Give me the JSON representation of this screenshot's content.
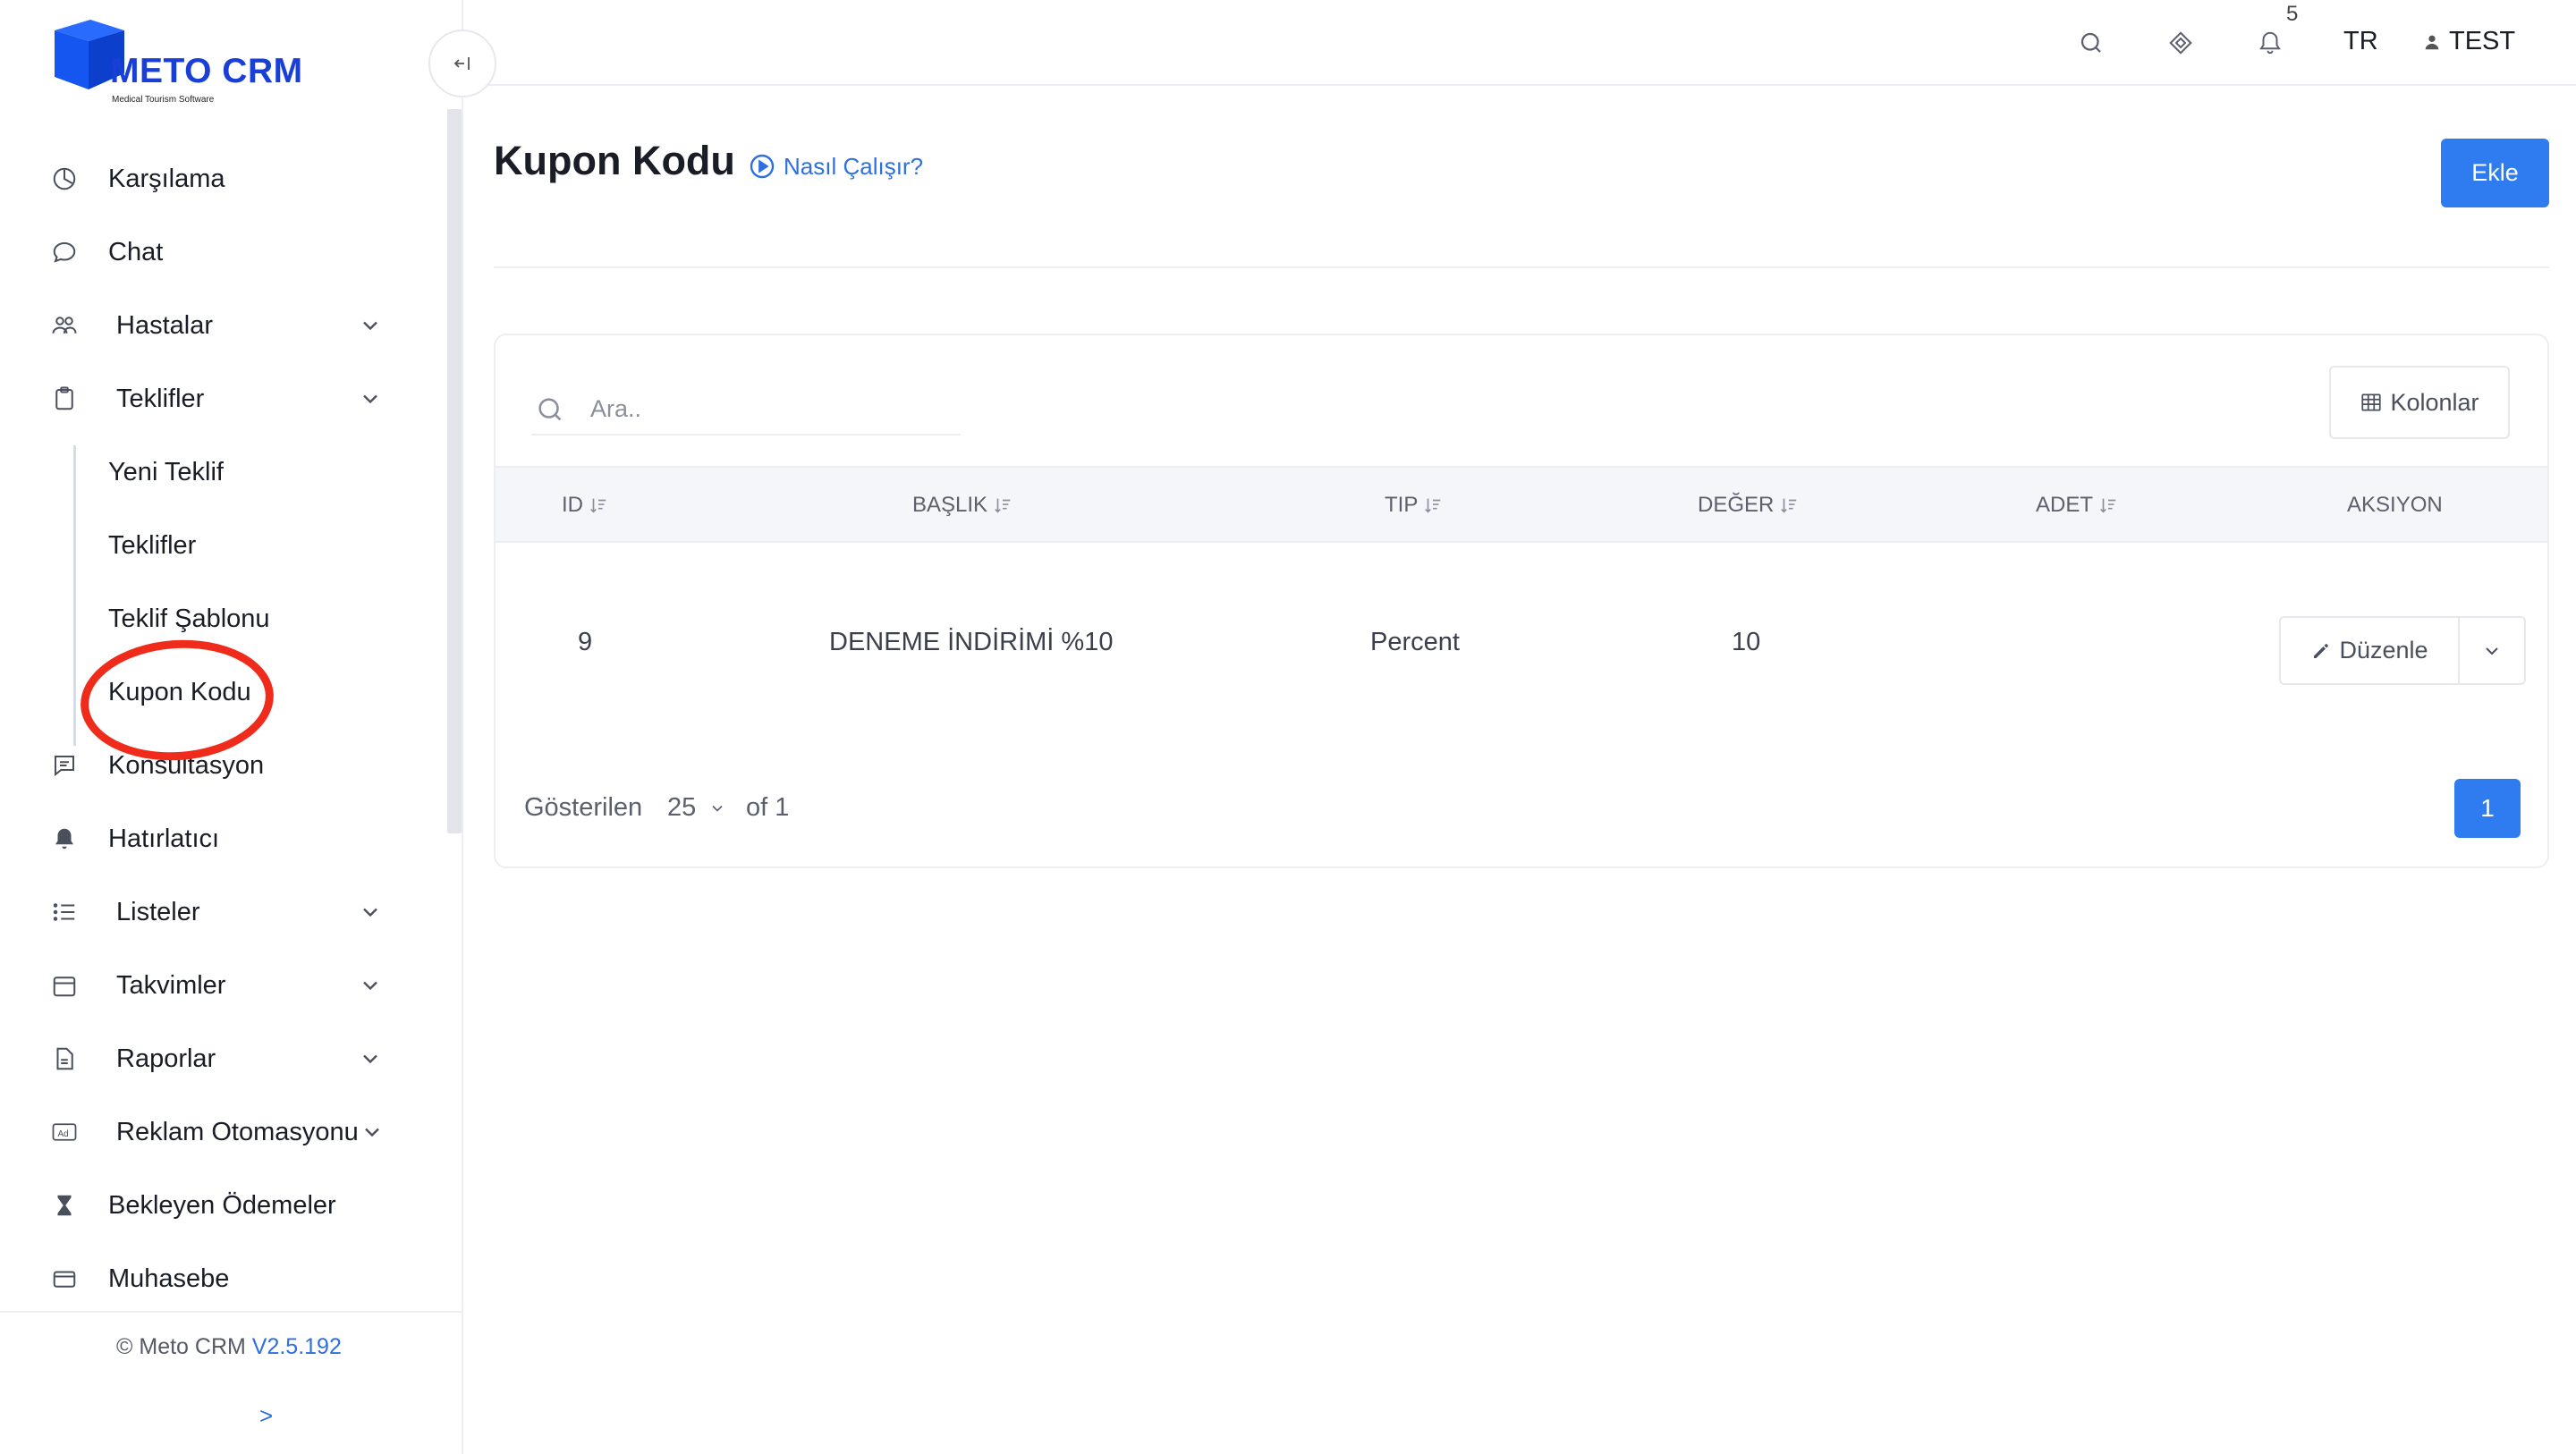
{
  "brand": {
    "name": "METO CRM",
    "tagline": "Medical Tourism Software",
    "accent": "#1a3fd6"
  },
  "sidebar": {
    "items": [
      {
        "label": "Karşılama",
        "icon": "dashboard-icon"
      },
      {
        "label": "Chat",
        "icon": "chat-icon"
      },
      {
        "label": "Hastalar",
        "icon": "users-icon",
        "expandable": true
      },
      {
        "label": "Teklifler",
        "icon": "clipboard-icon",
        "expandable": true,
        "expanded": true
      },
      {
        "label": "Yeni Teklif",
        "sub": true
      },
      {
        "label": "Teklifler",
        "sub": true
      },
      {
        "label": "Teklif Şablonu",
        "sub": true
      },
      {
        "label": "Kupon Kodu",
        "sub": true,
        "active": true
      },
      {
        "label": "Konsultasyon",
        "icon": "message-square-icon"
      },
      {
        "label": "Hatırlatıcı",
        "icon": "bell-icon"
      },
      {
        "label": "Listeler",
        "icon": "list-icon",
        "expandable": true
      },
      {
        "label": "Takvimler",
        "icon": "calendar-icon",
        "expandable": true
      },
      {
        "label": "Raporlar",
        "icon": "file-icon",
        "expandable": true
      },
      {
        "label": "Reklam Otomasyonu",
        "icon": "ad-icon",
        "expandable": true
      },
      {
        "label": "Bekleyen Ödemeler",
        "icon": "hourglass-icon"
      },
      {
        "label": "Muhasebe",
        "icon": "credit-card-icon"
      }
    ],
    "footer": {
      "copyright": "© Meto CRM",
      "version": "V2.5.192",
      "expand": ">"
    }
  },
  "topbar": {
    "notification_count": "5",
    "language": "TR",
    "user": "TEST"
  },
  "page": {
    "title": "Kupon Kodu",
    "how_it_works": "Nasıl Çalışır?",
    "add_button": "Ekle"
  },
  "table": {
    "search_placeholder": "Ara..",
    "columns_button": "Kolonlar",
    "headers": [
      "ID",
      "BAŞLIK",
      "TIP",
      "DEĞER",
      "ADET",
      "AKSIYON"
    ],
    "rows": [
      {
        "id": "9",
        "title": "DENEME İNDİRİMİ %10",
        "type": "Percent",
        "value": "10",
        "count": ""
      }
    ],
    "edit_label": "Düzenle",
    "shown_label": "Gösterilen",
    "page_size": "25",
    "of_total": "of 1",
    "current_page": "1"
  },
  "colors": {
    "primary": "#2f7bf0",
    "link": "#2f6fde",
    "annotation_ring": "#ef2c1c"
  }
}
